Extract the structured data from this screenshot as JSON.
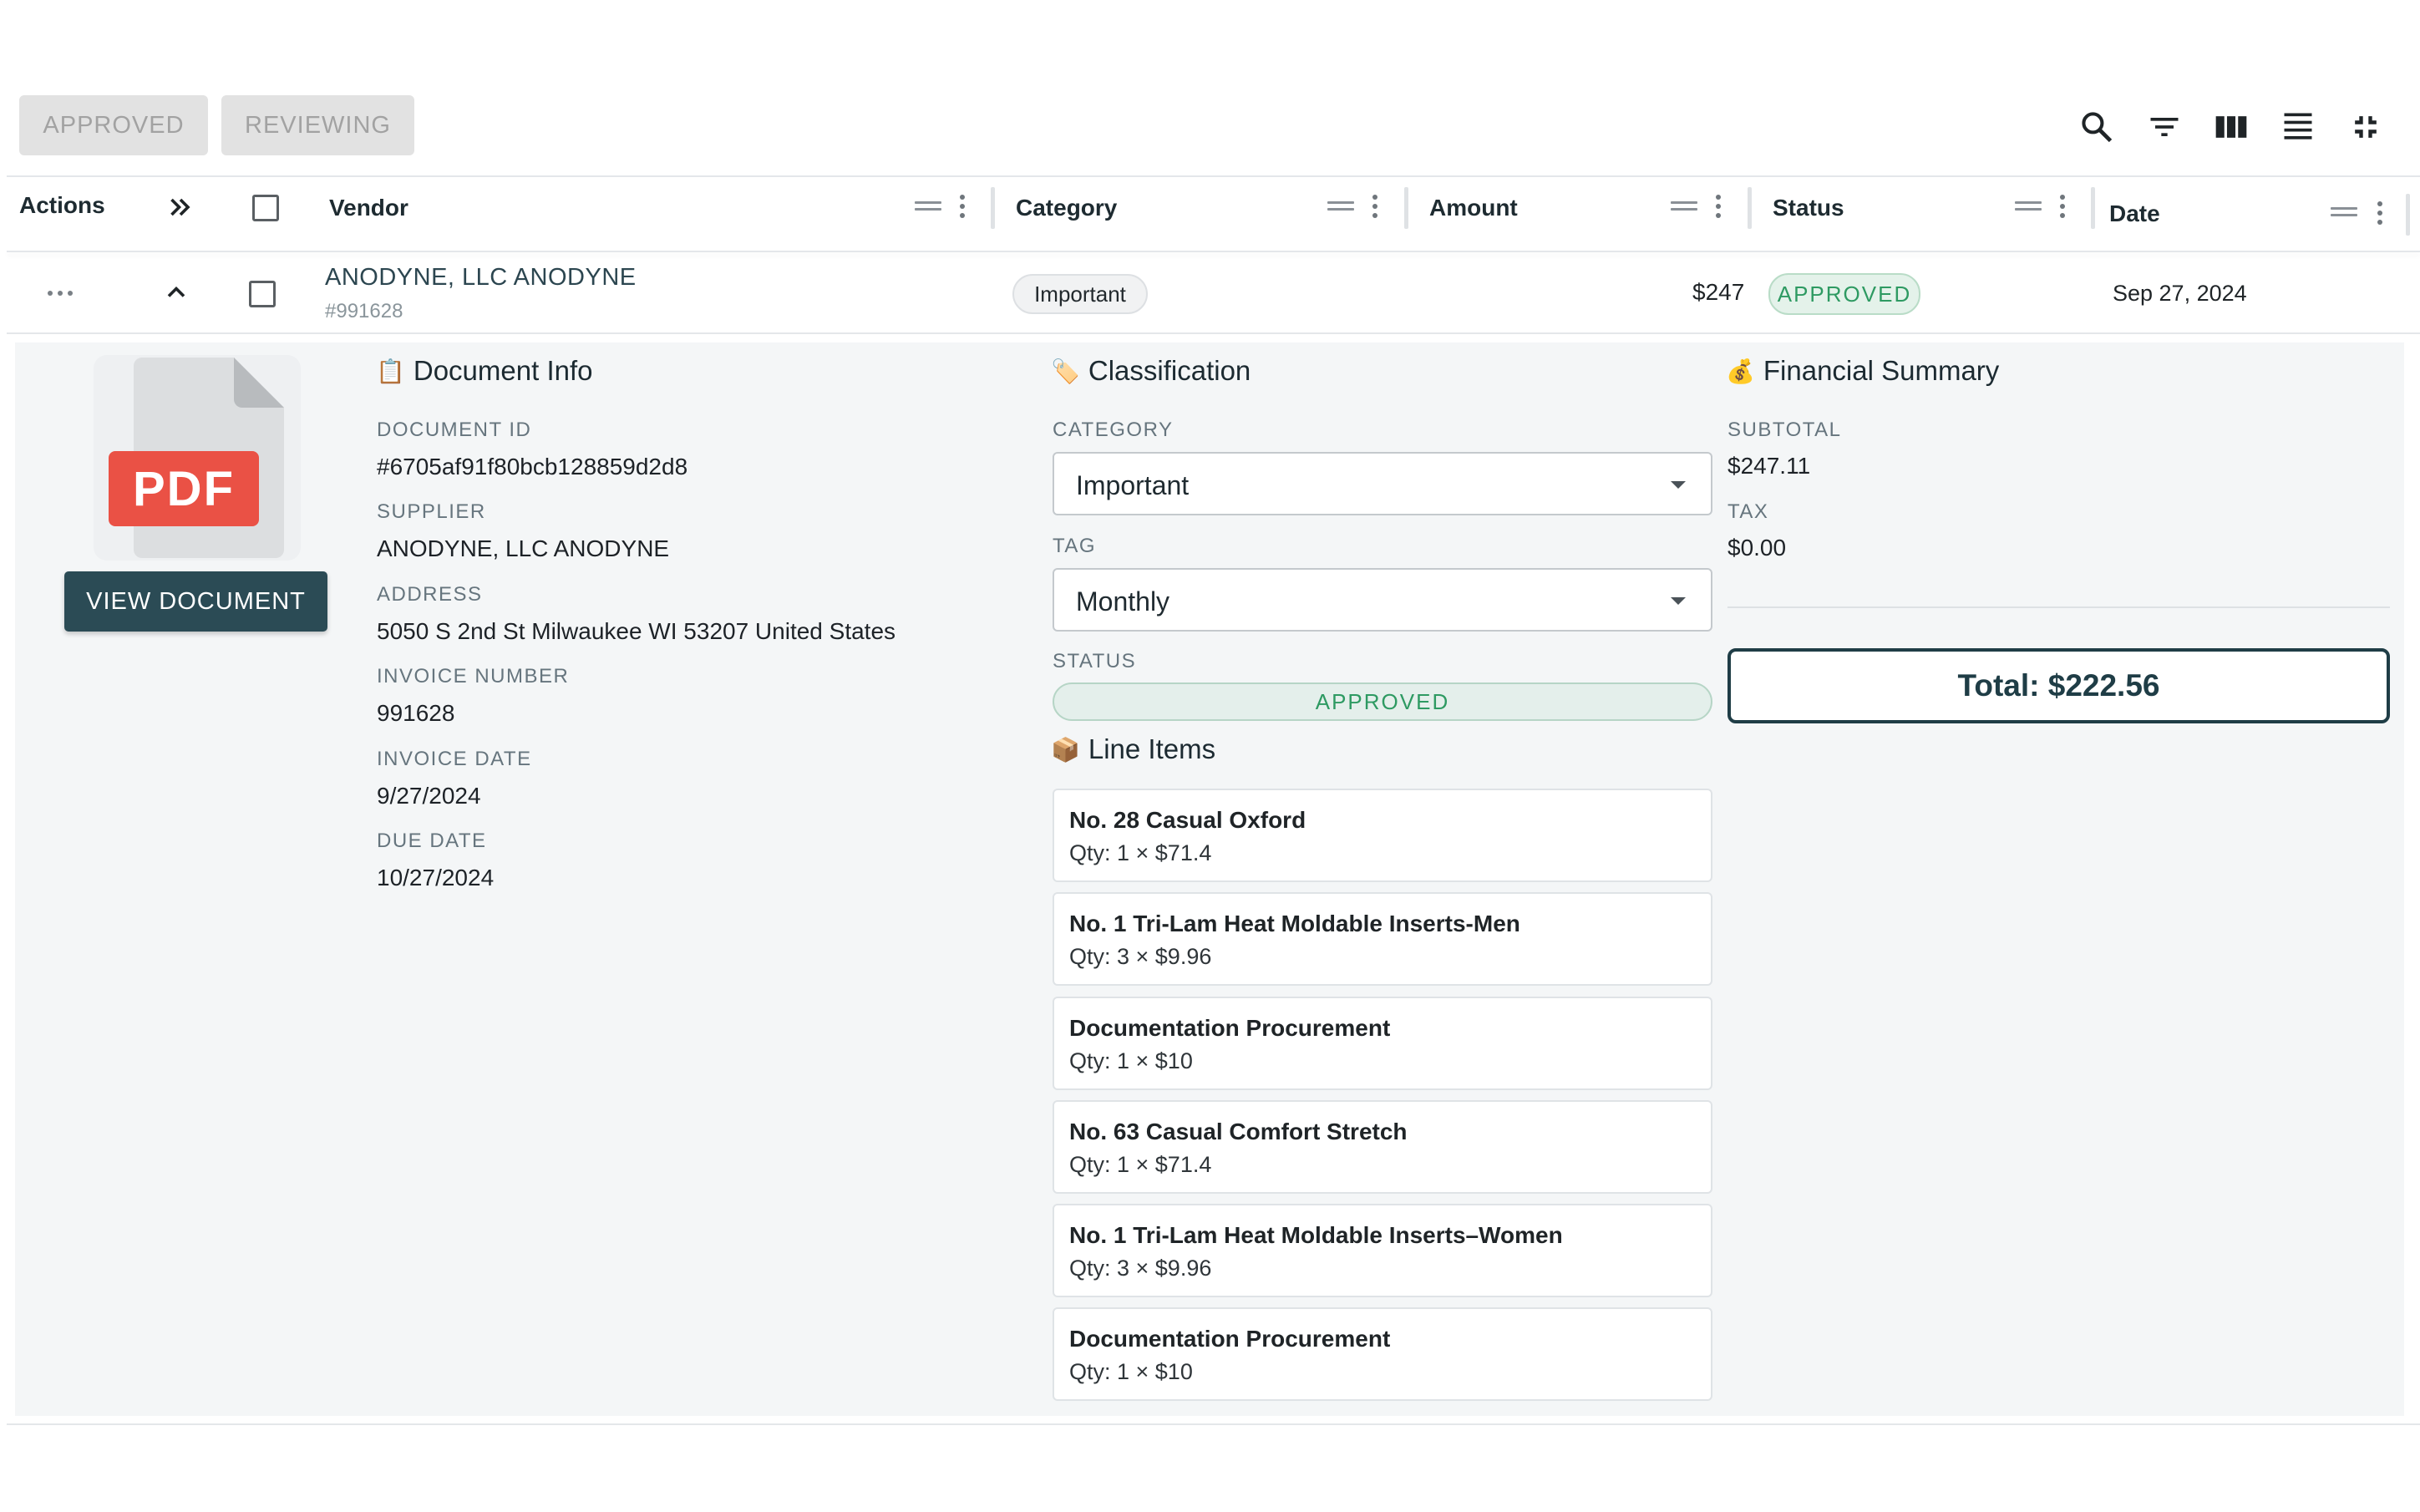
{
  "toolbar": {
    "chips": [
      "APPROVED",
      "REVIEWING"
    ],
    "icons": [
      "search-icon",
      "filter-icon",
      "columns-icon",
      "density-icon",
      "fullscreen-exit-icon"
    ]
  },
  "table": {
    "headers": {
      "actions": "Actions",
      "vendor": "Vendor",
      "category": "Category",
      "amount": "Amount",
      "status": "Status",
      "date": "Date"
    },
    "row": {
      "vendor": "ANODYNE, LLC ANODYNE",
      "vendor_sub": "#991628",
      "category": "Important",
      "amount": "$247",
      "status": "APPROVED",
      "date": "Sep 27, 2024"
    }
  },
  "detail": {
    "view_document": "VIEW DOCUMENT",
    "pdf_label": "PDF",
    "doc_info": {
      "title": "Document Info",
      "emoji": "📋",
      "fields": [
        {
          "label": "DOCUMENT ID",
          "value": "#6705af91f80bcb128859d2d8"
        },
        {
          "label": "SUPPLIER",
          "value": "ANODYNE, LLC ANODYNE"
        },
        {
          "label": "ADDRESS",
          "value": "5050 S 2nd St Milwaukee WI 53207 United States"
        },
        {
          "label": "INVOICE NUMBER",
          "value": "991628"
        },
        {
          "label": "INVOICE DATE",
          "value": "9/27/2024"
        },
        {
          "label": "DUE DATE",
          "value": "10/27/2024"
        }
      ]
    },
    "classification": {
      "title": "Classification",
      "emoji": "🏷️",
      "category_label": "CATEGORY",
      "category_value": "Important",
      "tag_label": "TAG",
      "tag_value": "Monthly",
      "status_label": "STATUS",
      "status_value": "APPROVED"
    },
    "line_items": {
      "title": "Line Items",
      "emoji": "📦",
      "items": [
        {
          "name": "No. 28 Casual Oxford",
          "qty": "Qty: 1 × $71.4"
        },
        {
          "name": "No. 1 Tri-Lam Heat Moldable Inserts-Men",
          "qty": "Qty: 3 × $9.96"
        },
        {
          "name": "Documentation Procurement",
          "qty": "Qty: 1 × $10"
        },
        {
          "name": "No. 63 Casual Comfort Stretch",
          "qty": "Qty: 1 × $71.4"
        },
        {
          "name": "No. 1 Tri-Lam Heat Moldable Inserts–Women",
          "qty": "Qty: 3 × $9.96"
        },
        {
          "name": "Documentation Procurement",
          "qty": "Qty: 1 × $10"
        }
      ]
    },
    "financial": {
      "title": "Financial Summary",
      "emoji": "💰",
      "subtotal_label": "SUBTOTAL",
      "subtotal_value": "$247.11",
      "tax_label": "TAX",
      "tax_value": "$0.00",
      "total": "Total: $222.56"
    }
  },
  "colors": {
    "accent": "#2b4b55",
    "approved_green": "#2e9a62",
    "approved_bg": "#e4f2ea"
  }
}
